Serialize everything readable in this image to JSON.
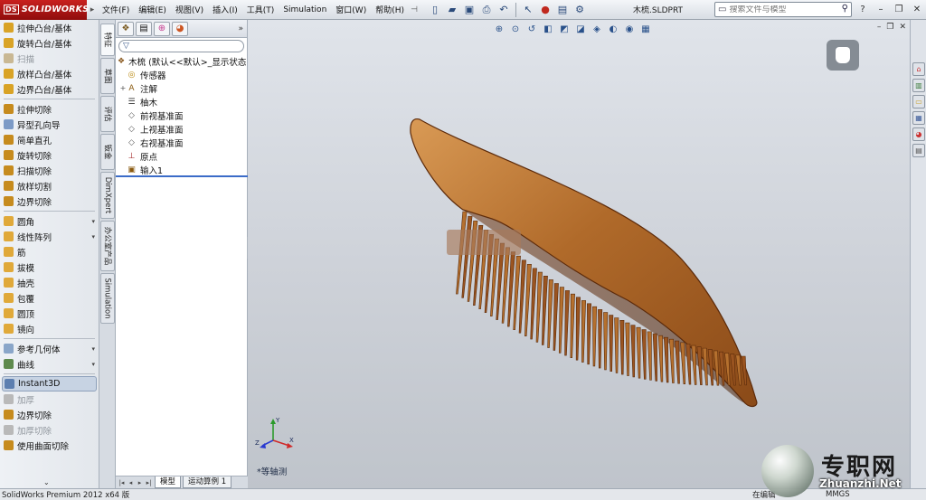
{
  "app": {
    "logo_text": "SOLIDWORKS",
    "logo_ds": "DS",
    "document_title": "木梳.SLDPRT",
    "menus": [
      "文件(F)",
      "编辑(E)",
      "视图(V)",
      "插入(I)",
      "工具(T)",
      "Simulation",
      "窗口(W)",
      "帮助(H)"
    ],
    "search_placeholder": "搜索文件与模型"
  },
  "command_groups": [
    [
      {
        "label": "拉伸凸台/基体",
        "color": "#d9a326",
        "enabled": true
      },
      {
        "label": "旋转凸台/基体",
        "color": "#d9a326",
        "enabled": true
      },
      {
        "label": "扫描",
        "color": "#c9b894",
        "enabled": false
      },
      {
        "label": "放样凸台/基体",
        "color": "#d9a326",
        "enabled": true
      },
      {
        "label": "边界凸台/基体",
        "color": "#d9a326",
        "enabled": true
      }
    ],
    [
      {
        "label": "拉伸切除",
        "color": "#c68b1e",
        "enabled": true
      },
      {
        "label": "异型孔向导",
        "color": "#7c9ac6",
        "enabled": true
      },
      {
        "label": "简单直孔",
        "color": "#c68b1e",
        "enabled": true
      },
      {
        "label": "旋转切除",
        "color": "#c68b1e",
        "enabled": true
      },
      {
        "label": "扫描切除",
        "color": "#c68b1e",
        "enabled": true
      },
      {
        "label": "放样切割",
        "color": "#c68b1e",
        "enabled": true
      },
      {
        "label": "边界切除",
        "color": "#c68b1e",
        "enabled": true
      }
    ],
    [
      {
        "label": "圆角",
        "color": "#e0a93a",
        "enabled": true,
        "dropdown": true
      },
      {
        "label": "线性阵列",
        "color": "#e0a93a",
        "enabled": true,
        "dropdown": true
      },
      {
        "label": "筋",
        "color": "#e0a93a",
        "enabled": true
      },
      {
        "label": "拔模",
        "color": "#e0a93a",
        "enabled": true
      },
      {
        "label": "抽壳",
        "color": "#e0a93a",
        "enabled": true
      },
      {
        "label": "包覆",
        "color": "#e0a93a",
        "enabled": true
      },
      {
        "label": "圆顶",
        "color": "#e0a93a",
        "enabled": true
      },
      {
        "label": "镜向",
        "color": "#e0a93a",
        "enabled": true
      }
    ],
    [
      {
        "label": "参考几何体",
        "color": "#8aa6c9",
        "enabled": true,
        "dropdown": true
      },
      {
        "label": "曲线",
        "color": "#5e8a4d",
        "enabled": true,
        "dropdown": true
      }
    ],
    [
      {
        "label": "Instant3D",
        "color": "#5d7fb0",
        "enabled": true,
        "active": true
      },
      {
        "label": "加厚",
        "color": "#b9b9b9",
        "enabled": false
      },
      {
        "label": "边界切除",
        "color": "#c68b1e",
        "enabled": true
      },
      {
        "label": "加厚切除",
        "color": "#b9b9b9",
        "enabled": false
      },
      {
        "label": "使用曲面切除",
        "color": "#c68b1e",
        "enabled": true
      }
    ]
  ],
  "vertical_tabs": [
    "特征",
    "草图",
    "评估",
    "钣金",
    "DimXpert",
    "办公室产品",
    "Simulation"
  ],
  "tree": {
    "root": "木梳  (默认<<默认>_显示状态 1",
    "items": [
      {
        "label": "传感器",
        "icon": "sensor-icon",
        "expander": ""
      },
      {
        "label": "注解",
        "icon": "annotation-icon",
        "expander": "+"
      },
      {
        "label": "柚木",
        "icon": "material-icon",
        "expander": ""
      },
      {
        "label": "前视基准面",
        "icon": "plane-icon",
        "expander": ""
      },
      {
        "label": "上视基准面",
        "icon": "plane-icon",
        "expander": ""
      },
      {
        "label": "右视基准面",
        "icon": "plane-icon",
        "expander": ""
      },
      {
        "label": "原点",
        "icon": "origin-icon",
        "expander": ""
      },
      {
        "label": "输入1",
        "icon": "import-icon",
        "expander": ""
      }
    ]
  },
  "bottom_tabs": [
    "模型",
    "运动算例 1"
  ],
  "viewport": {
    "view_name": "*等轴测",
    "triad": {
      "x": "X",
      "y": "Y",
      "z": "Z"
    }
  },
  "status": {
    "text": "SolidWorks Premium 2012 x64 版",
    "mode": "在编辑",
    "units": "MMGS"
  },
  "watermark": {
    "cn": "专职网",
    "en": "Zhuanzhi.Net"
  },
  "colors": {
    "wood_dark": "#7a3d0f",
    "wood_mid": "#b06a2a",
    "wood_light": "#d89a55",
    "accent": "#3b6cc8"
  }
}
